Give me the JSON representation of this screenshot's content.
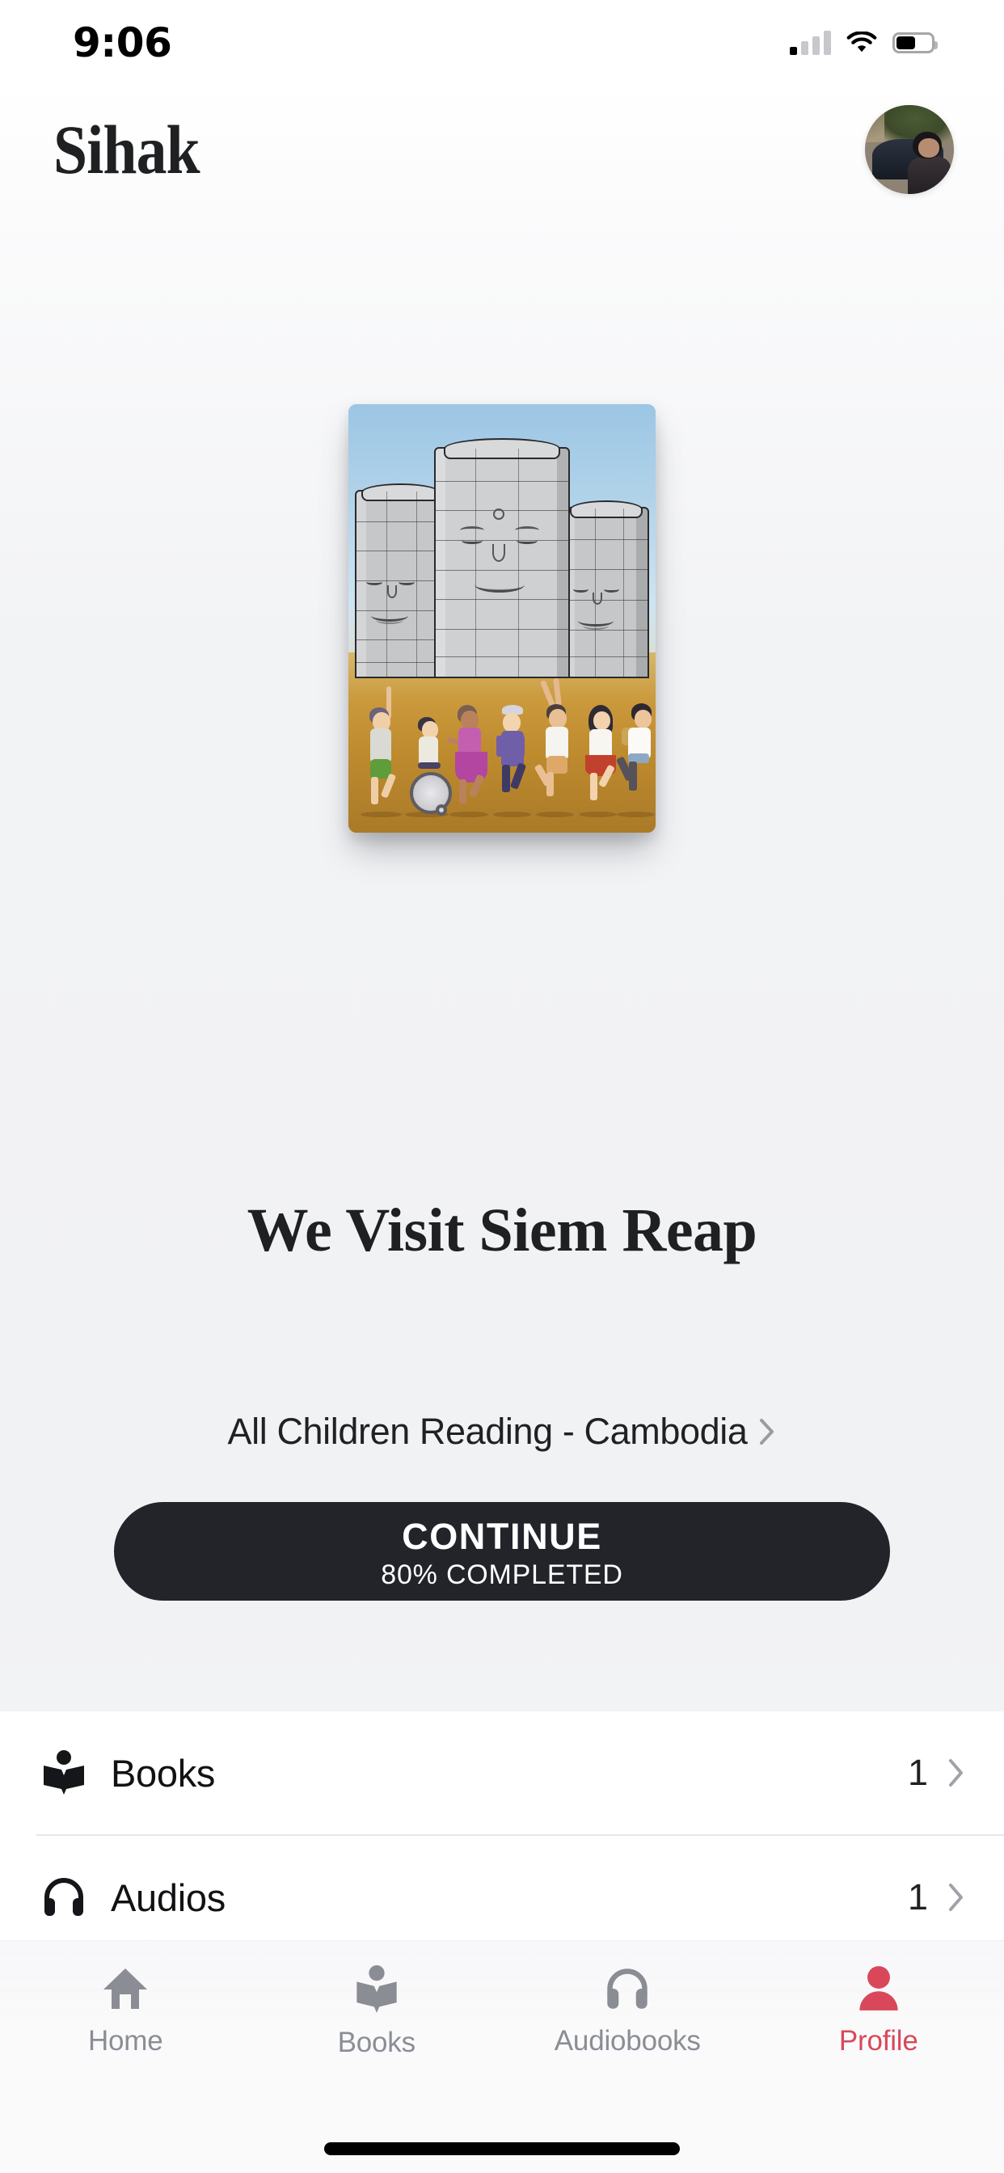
{
  "status_bar": {
    "time": "9:06",
    "cellular_icon": "cellular-signal-icon",
    "cellular_bars_filled": 1,
    "cellular_bars_total": 4,
    "wifi_icon": "wifi-icon",
    "battery_icon": "battery-icon",
    "battery_level_percent": 55
  },
  "header": {
    "title": "Sihak",
    "avatar_name": "user-avatar"
  },
  "hero": {
    "cover_alt": "we-visit-siem-reap-cover",
    "book_title": "We Visit Siem Reap",
    "publisher": "All Children Reading - Cambodia",
    "publisher_chevron": "chevron-right-icon",
    "continue_label": "CONTINUE",
    "progress_label": "80% COMPLETED",
    "progress_percent": 80
  },
  "list": {
    "rows": [
      {
        "icon": "open-book-icon",
        "label": "Books",
        "count": "1",
        "chevron": "chevron-right-icon"
      },
      {
        "icon": "headphones-icon",
        "label": "Audios",
        "count": "1",
        "chevron": "chevron-right-icon"
      }
    ]
  },
  "tabbar": {
    "tabs": [
      {
        "icon": "home-icon",
        "label": "Home",
        "active": false
      },
      {
        "icon": "open-book-icon",
        "label": "Books",
        "active": false
      },
      {
        "icon": "headphones-icon",
        "label": "Audiobooks",
        "active": false
      },
      {
        "icon": "person-icon",
        "label": "Profile",
        "active": true
      }
    ]
  },
  "colors": {
    "accent": "#d9485a",
    "inactive": "#8b8d94",
    "text_primary": "#1e2022",
    "button_bg": "#22242a",
    "hero_bg": "#f2f3f5",
    "divider": "#e6e7e9"
  }
}
